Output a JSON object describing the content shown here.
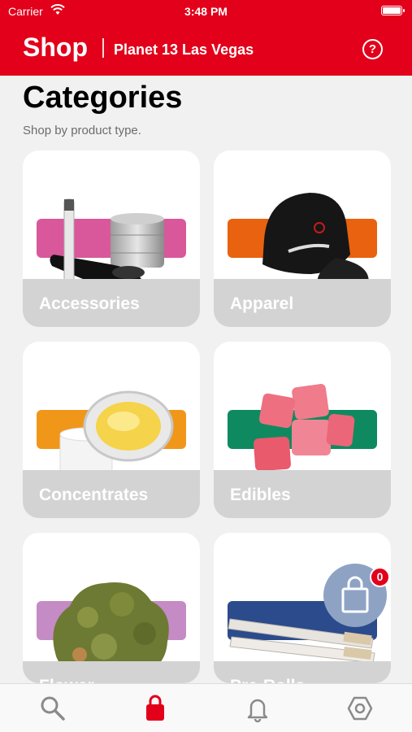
{
  "status_bar": {
    "carrier": "Carrier",
    "time": "3:48 PM"
  },
  "header": {
    "title": "Shop",
    "store": "Planet 13 Las Vegas",
    "help_glyph": "?"
  },
  "page": {
    "title": "Categories",
    "subtitle": "Shop by product type."
  },
  "categories": [
    {
      "label": "Accessories",
      "band_color": "#d9589c"
    },
    {
      "label": "Apparel",
      "band_color": "#e8620f"
    },
    {
      "label": "Concentrates",
      "band_color": "#f0971a"
    },
    {
      "label": "Edibles",
      "band_color": "#0f8a60"
    },
    {
      "label": "Flower",
      "band_color": "#c48bc4"
    },
    {
      "label": "Pre-Rolls",
      "band_color": "#2b4b8c"
    }
  ],
  "cart": {
    "count": "0"
  },
  "tabs": [
    {
      "name": "search",
      "icon": "search-icon"
    },
    {
      "name": "shop",
      "icon": "shopping-bag-icon",
      "active": true
    },
    {
      "name": "notifications",
      "icon": "bell-icon"
    },
    {
      "name": "settings",
      "icon": "hexagon-settings-icon"
    }
  ],
  "colors": {
    "brand_red": "#e2001a",
    "cart_fab": "#8ea3c4",
    "tab_inactive": "#8a8a8a"
  }
}
